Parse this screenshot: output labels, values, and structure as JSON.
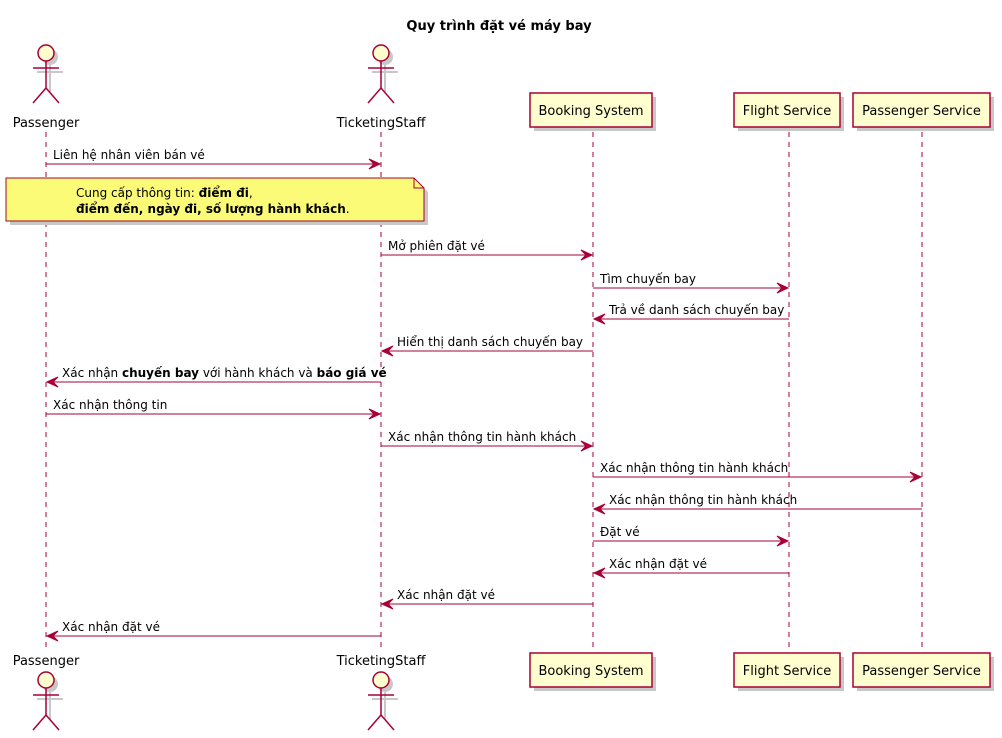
{
  "title": "Quy trình đặt vé máy bay",
  "colors": {
    "line": "#A80036",
    "participant_fill": "#FEFECE",
    "note_fill": "#FBFB77",
    "shadow": "#C8C8C8"
  },
  "participants": [
    {
      "id": "passenger",
      "label": "Passenger",
      "kind": "actor"
    },
    {
      "id": "staff",
      "label": "TicketingStaff",
      "kind": "actor"
    },
    {
      "id": "booking",
      "label": "Booking System",
      "kind": "box"
    },
    {
      "id": "flight",
      "label": "Flight Service",
      "kind": "box"
    },
    {
      "id": "passvc",
      "label": "Passenger Service",
      "kind": "box"
    }
  ],
  "note": {
    "over": [
      "passenger",
      "staff"
    ],
    "lines": [
      [
        {
          "t": "Cung cấp thông tin: ",
          "b": false
        },
        {
          "t": "điểm đi",
          "b": true
        },
        {
          "t": ",",
          "b": false
        }
      ],
      [
        {
          "t": "điểm đến, ngày đi, số lượng hành khách",
          "b": true
        },
        {
          "t": ".",
          "b": false
        }
      ]
    ]
  },
  "messages": [
    {
      "from": "passenger",
      "to": "staff",
      "parts": [
        {
          "t": "Liên hệ nhân viên bán vé",
          "b": false
        }
      ]
    },
    {
      "from": "staff",
      "to": "booking",
      "parts": [
        {
          "t": "Mở phiên đặt vé",
          "b": false
        }
      ]
    },
    {
      "from": "booking",
      "to": "flight",
      "parts": [
        {
          "t": "Tìm chuyến bay",
          "b": false
        }
      ]
    },
    {
      "from": "flight",
      "to": "booking",
      "parts": [
        {
          "t": "Trả về danh sách chuyến bay",
          "b": false
        }
      ]
    },
    {
      "from": "booking",
      "to": "staff",
      "parts": [
        {
          "t": "Hiển thị danh sách chuyến bay",
          "b": false
        }
      ]
    },
    {
      "from": "staff",
      "to": "passenger",
      "parts": [
        {
          "t": "Xác nhận ",
          "b": false
        },
        {
          "t": "chuyến bay",
          "b": true
        },
        {
          "t": " với hành khách và ",
          "b": false
        },
        {
          "t": "báo giá vé",
          "b": true
        }
      ]
    },
    {
      "from": "passenger",
      "to": "staff",
      "parts": [
        {
          "t": "Xác nhận thông tin",
          "b": false
        }
      ]
    },
    {
      "from": "staff",
      "to": "booking",
      "parts": [
        {
          "t": "Xác nhận thông tin hành khách",
          "b": false
        }
      ]
    },
    {
      "from": "booking",
      "to": "passvc",
      "parts": [
        {
          "t": "Xác nhận thông tin hành khách",
          "b": false
        }
      ]
    },
    {
      "from": "passvc",
      "to": "booking",
      "parts": [
        {
          "t": "Xác nhận thông tin hành khách",
          "b": false
        }
      ]
    },
    {
      "from": "booking",
      "to": "flight",
      "parts": [
        {
          "t": "Đặt vé",
          "b": false
        }
      ]
    },
    {
      "from": "flight",
      "to": "booking",
      "parts": [
        {
          "t": "Xác nhận đặt vé",
          "b": false
        }
      ]
    },
    {
      "from": "booking",
      "to": "staff",
      "parts": [
        {
          "t": "Xác nhận đặt vé",
          "b": false
        }
      ]
    },
    {
      "from": "staff",
      "to": "passenger",
      "parts": [
        {
          "t": "Xác nhận đặt vé",
          "b": false
        }
      ]
    }
  ]
}
